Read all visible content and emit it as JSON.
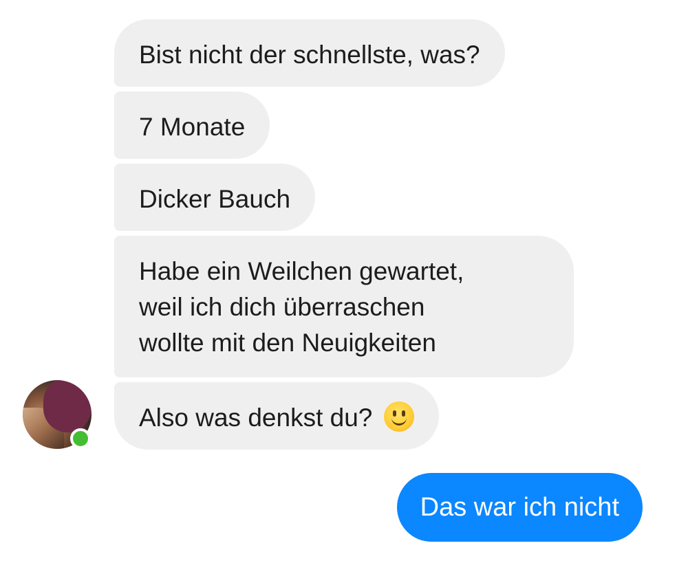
{
  "thread": {
    "incoming": [
      {
        "text": "Bist nicht der schnellste, was?"
      },
      {
        "text": "7 Monate"
      },
      {
        "text": "Dicker Bauch"
      },
      {
        "lines": [
          "Habe ein Weilchen gewartet,",
          "weil ich dich überraschen",
          "wollte mit den Neuigkeiten"
        ]
      },
      {
        "text": "Also was denkst du?",
        "emoji": "slightly-smiling-face-icon"
      }
    ],
    "outgoing": [
      {
        "text": "Das war ich nicht"
      }
    ]
  },
  "contact": {
    "avatar": "avatar-photo",
    "status": "online",
    "status_color": "#44bd32"
  },
  "colors": {
    "incoming_bubble": "#efefef",
    "outgoing_bubble": "#0b87ff",
    "text_dark": "#1c1c1c",
    "text_light": "#ffffff"
  }
}
